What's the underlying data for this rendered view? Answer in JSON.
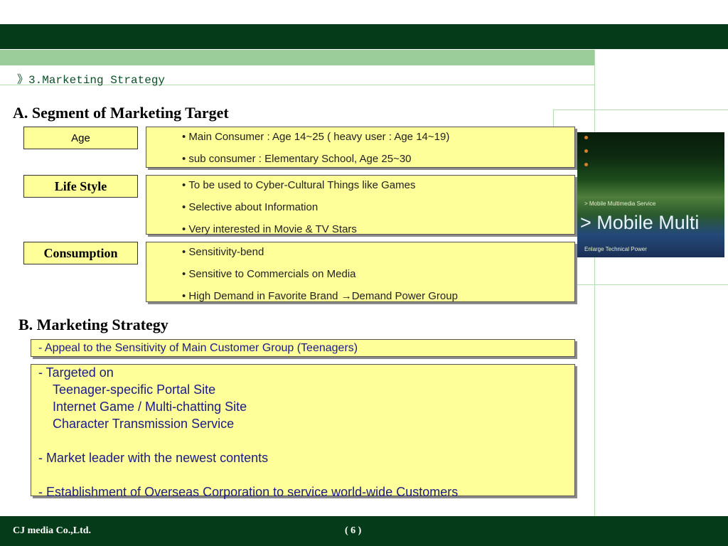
{
  "breadcrumb": "》3.Marketing Strategy",
  "section_a": {
    "title": "A. Segment of Marketing Target",
    "segments": [
      {
        "label": "Age",
        "items": [
          "Main Consumer : Age 14~25 ( heavy user : Age 14~19)",
          "sub consumer : Elementary School, Age 25~30"
        ]
      },
      {
        "label": "Life Style",
        "items": [
          "To be used to Cyber-Cultural Things like Games",
          "Selective about Information",
          "Very interested in Movie & TV Stars"
        ]
      },
      {
        "label": "Consumption",
        "items": [
          "Sensitivity-bend",
          "Sensitive to Commercials on Media",
          "High Demand in Favorite Brand →Demand Power Group"
        ]
      }
    ]
  },
  "photo": {
    "line1": "> Mobile Multimedia Service",
    "big_text": "> Mobile Multi",
    "line2": "Enlarge Technical Power"
  },
  "section_b": {
    "title": "B. Marketing Strategy",
    "headline": "- Appeal to the Sensitivity of Main Customer Group (Teenagers)",
    "targeted_on": "- Targeted on",
    "targets": [
      "Teenager-specific Portal Site",
      "Internet Game / Multi-chatting Site",
      "Character Transmission Service"
    ],
    "market_leader": "- Market leader with the newest contents",
    "overseas": "- Establishment of Overseas Corporation to service world-wide Customers"
  },
  "footer": {
    "company": "CJ media Co.,Ltd.",
    "page": "( 6 )"
  },
  "colors": {
    "dark_green": "#063b19",
    "light_green": "#9acd9a",
    "box_yellow": "#ffff99",
    "text_blue": "#1a1a8a"
  }
}
